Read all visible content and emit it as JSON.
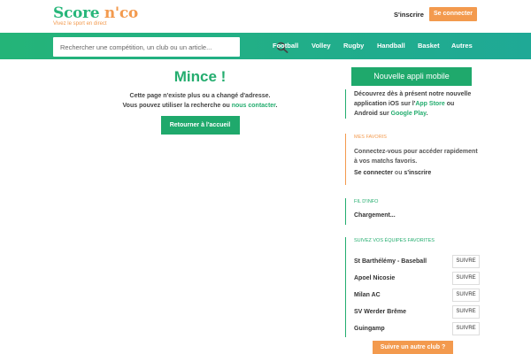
{
  "header": {
    "logo_score": "Score",
    "logo_nco": "n'co",
    "logo_tagline": "Vivez le sport en direct",
    "signup_label": "S'inscrire",
    "login_label": "Se connecter"
  },
  "nav": {
    "search_placeholder": "Rechercher une compétition, un club ou un article...",
    "search_icon": "search-icon",
    "items": [
      {
        "label": "Football"
      },
      {
        "label": "Volley"
      },
      {
        "label": "Rugby"
      },
      {
        "label": "Handball"
      },
      {
        "label": "Basket"
      },
      {
        "label": "Autres"
      }
    ]
  },
  "main": {
    "title": "Mince !",
    "line1": "Cette page n'existe plus ou a changé d'adresse.",
    "line2_pre": "Vous pouvez utiliser la recherche ou ",
    "line2_link": "nous contacter",
    "line2_post": ".",
    "home_button": "Retourner à l'accueil"
  },
  "sidebar": {
    "app": {
      "button": "Nouvelle appli mobile",
      "text_pre": "Découvrez dès à présent notre nouvelle application iOS sur l'",
      "app_store": "App Store",
      "text_mid": " ou Android sur ",
      "google_play": "Google Play",
      "text_post": "."
    },
    "favorites": {
      "title": "MES FAVORIS",
      "text": "Connectez-vous pour accéder rapidement à vos matchs favoris.",
      "login_link": "Se connecter",
      "or": " ou ",
      "signup_link": "s'inscrire"
    },
    "feed": {
      "title": "FIL D'INFO",
      "text": "Chargement..."
    },
    "teams": {
      "title": "SUIVEZ VOS ÉQUIPES FAVORITES",
      "follow_label": "SUIVRE",
      "items": [
        {
          "name": "St Barthélémy - Baseball"
        },
        {
          "name": "Apoel Nicosie"
        },
        {
          "name": "Milan AC"
        },
        {
          "name": "SV Werder Brême"
        },
        {
          "name": "Guingamp"
        }
      ],
      "other_button": "Suivre un autre club ?"
    }
  },
  "colors": {
    "green": "#24ad6f",
    "orange": "#f39a4e"
  }
}
